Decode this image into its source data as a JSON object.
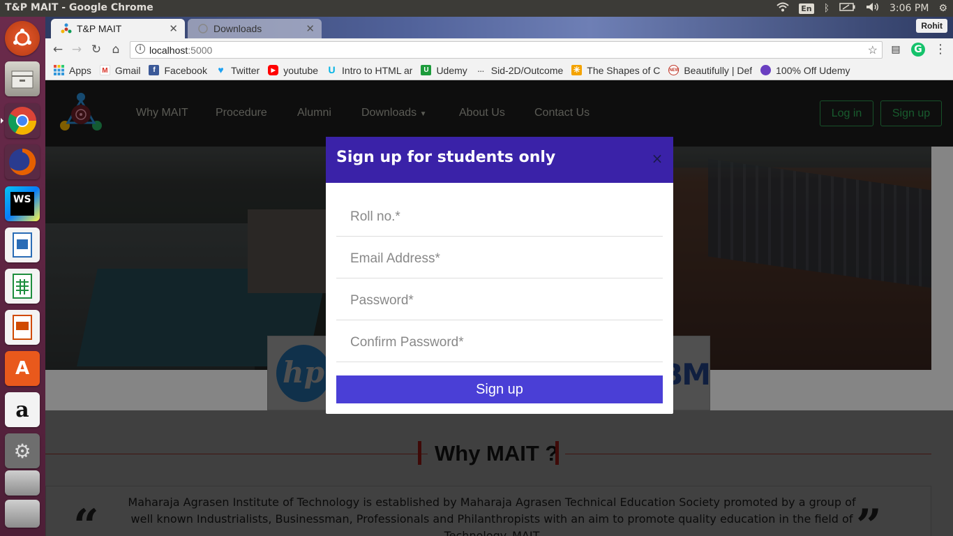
{
  "os": {
    "window_title": "T&P MAIT - Google Chrome",
    "keyboard_layout": "En",
    "time": "3:06 PM",
    "icons": [
      "wifi-icon",
      "bluetooth-icon",
      "battery-icon",
      "volume-icon",
      "settings-gear-icon"
    ],
    "launcher": [
      {
        "name": "ubuntu-dash-icon",
        "color": "#dd4814"
      },
      {
        "name": "file-manager-icon",
        "color": "#8a8a84"
      },
      {
        "name": "chrome-icon",
        "color": "#4285f4"
      },
      {
        "name": "firefox-icon",
        "color": "#e66000"
      },
      {
        "name": "webstorm-icon",
        "color": "#07c3f2"
      },
      {
        "name": "libreoffice-writer-icon",
        "color": "#2a6cb6"
      },
      {
        "name": "libreoffice-calc-icon",
        "color": "#1e8e3e"
      },
      {
        "name": "libreoffice-impress-icon",
        "color": "#d04a02"
      },
      {
        "name": "software-center-icon",
        "color": "#e9591c"
      },
      {
        "name": "amazon-icon",
        "color": "#f3f3f3"
      },
      {
        "name": "system-settings-icon",
        "color": "#888"
      },
      {
        "name": "drive-icon",
        "color": "#aaa"
      },
      {
        "name": "drive-icon-2",
        "color": "#aaa"
      }
    ]
  },
  "browser": {
    "tabs": [
      {
        "title": "T&P MAIT",
        "active": true
      },
      {
        "title": "Downloads",
        "active": false
      }
    ],
    "profile": "Rohit",
    "url_host": "localhost",
    "url_port": ":5000",
    "bookmarks": [
      {
        "label": "Apps",
        "icon": "apps-grid-icon",
        "color": "#777"
      },
      {
        "label": "Gmail",
        "icon": "gmail-icon",
        "color": "#d93025"
      },
      {
        "label": "Facebook",
        "icon": "facebook-icon",
        "color": "#3b5998"
      },
      {
        "label": "Twitter",
        "icon": "twitter-icon",
        "color": "#1da1f2"
      },
      {
        "label": "youtube",
        "icon": "youtube-icon",
        "color": "#ff0000"
      },
      {
        "label": "Intro to HTML ar",
        "icon": "udacity-icon",
        "color": "#02b3e4"
      },
      {
        "label": "Udemy",
        "icon": "udemy-icon",
        "color": "#1c9b3b"
      },
      {
        "label": "Sid-2D/Outcome",
        "icon": "github-icon",
        "color": "#f2f2f2"
      },
      {
        "label": "The Shapes of C",
        "icon": "shapes-icon",
        "color": "#f4a300"
      },
      {
        "label": "Beautifully | Def",
        "icon": "new-icon",
        "color": "#c0392b"
      },
      {
        "label": "100% Off Udemy",
        "icon": "udemy-off-icon",
        "color": "#6a3fc1"
      }
    ]
  },
  "site": {
    "nav": [
      "Why MAIT",
      "Procedure",
      "Alumni",
      "Downloads",
      "About Us",
      "Contact Us"
    ],
    "login": "Log in",
    "signup": "Sign up",
    "partners": {
      "hp": "hp",
      "ibm": "IBM"
    },
    "why_title": "Why MAIT ?",
    "why_text": "Maharaja Agrasen Institute of Technology is established by Maharaja Agrasen Technical Education Society promoted by a group of well known Industrialists, Businessman, Professionals and Philanthropists with an aim to promote quality education in the field of Technology. MAIT",
    "quote_open": "“",
    "quote_close": "”"
  },
  "modal": {
    "title": "Sign up for students only",
    "close": "×",
    "fields": [
      {
        "placeholder": "Roll no.*"
      },
      {
        "placeholder": "Email Address*"
      },
      {
        "placeholder": "Password*"
      },
      {
        "placeholder": "Confirm Password*"
      }
    ],
    "submit": "Sign up"
  }
}
